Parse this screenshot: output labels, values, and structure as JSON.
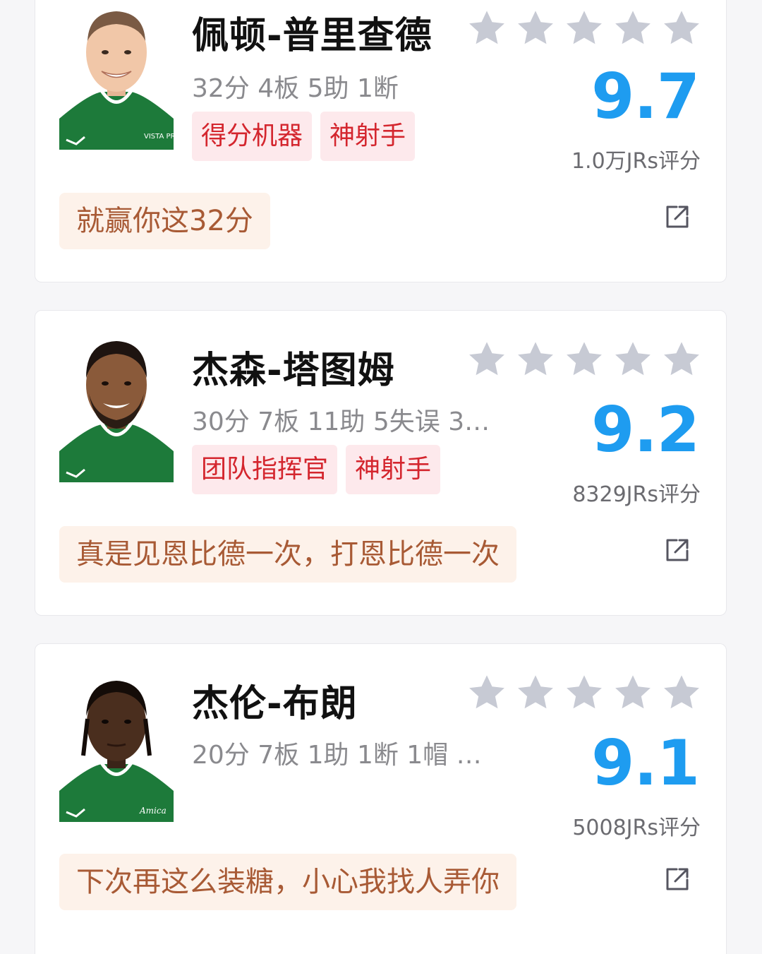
{
  "colors": {
    "score_blue": "#1e9cf0",
    "tag_text_red": "#d4262e",
    "tag_bg_pink": "#fde9ec",
    "comment_text": "#a85a35",
    "comment_bg": "#fdf2ea",
    "star_gray": "#c7cad4",
    "jersey_green": "#1d7a3a"
  },
  "players": [
    {
      "name": "佩顿-普里查德",
      "stats": "32分 4板 5助 1断",
      "score": "9.7",
      "rating_count": "1.0万JRs评分",
      "tags": [
        "得分机器",
        "神射手"
      ],
      "comment": "就赢你这32分",
      "jersey_text": "VISTA PRINT",
      "stars_filled": 0,
      "icons": {
        "avatar": "player-photo",
        "share": "share-icon"
      }
    },
    {
      "name": "杰森-塔图姆",
      "stats": "30分 7板 11助 5失误 3…",
      "score": "9.2",
      "rating_count": "8329JRs评分",
      "tags": [
        "团队指挥官",
        "神射手"
      ],
      "comment": "真是见恩比德一次，打恩比德一次",
      "stars_filled": 0,
      "icons": {
        "avatar": "player-photo",
        "share": "share-icon"
      }
    },
    {
      "name": "杰伦-布朗",
      "stats": "20分 7板 1助 1断 1帽 …",
      "score": "9.1",
      "rating_count": "5008JRs评分",
      "tags": [],
      "comment": "下次再这么装糖，小心我找人弄你",
      "jersey_text": "Amica",
      "stars_filled": 0,
      "icons": {
        "avatar": "player-photo",
        "share": "share-icon"
      }
    }
  ]
}
